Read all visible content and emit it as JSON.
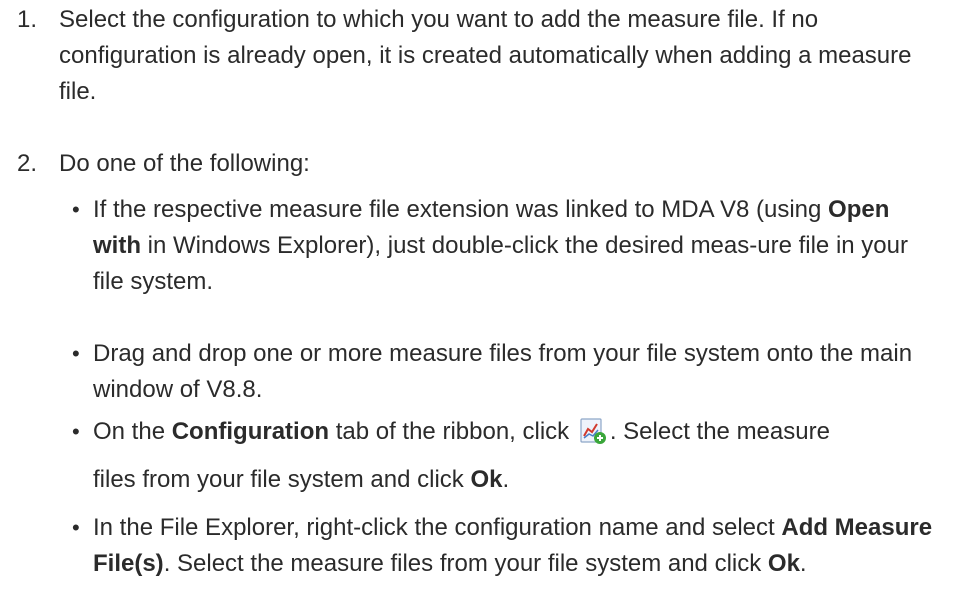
{
  "steps": [
    {
      "number": "1.",
      "text": "Select the configuration to which you want to add the measure file. If no configuration is already open, it is created automatically when adding a measure file."
    },
    {
      "number": "2.",
      "text": "Do one of the following:"
    }
  ],
  "bullets": {
    "b1": {
      "pre": "If the respective measure file extension was linked to MDA V8 (using ",
      "bold": "Open with",
      "post": " in Windows Explorer), just double-click the desired meas-ure file in your file system."
    },
    "b2": {
      "text": "Drag and drop one or more measure files from your file system onto the main window of V8.8."
    },
    "b3": {
      "pre": "On the ",
      "bold1": "Configuration",
      "mid": " tab of the ribbon, click ",
      "after_icon": ". Select the measure",
      "line2_pre": "files from your file system and click ",
      "bold2": "Ok",
      "line2_post": ".",
      "icon": "add-measure-file-icon"
    },
    "b4": {
      "pre": "In the File Explorer, right-click the configuration name and select ",
      "bold1": "Add Measure File(s)",
      "mid": ". Select the measure files from your file system and click ",
      "bold2": "Ok",
      "post": "."
    }
  },
  "bullet_char": "•"
}
